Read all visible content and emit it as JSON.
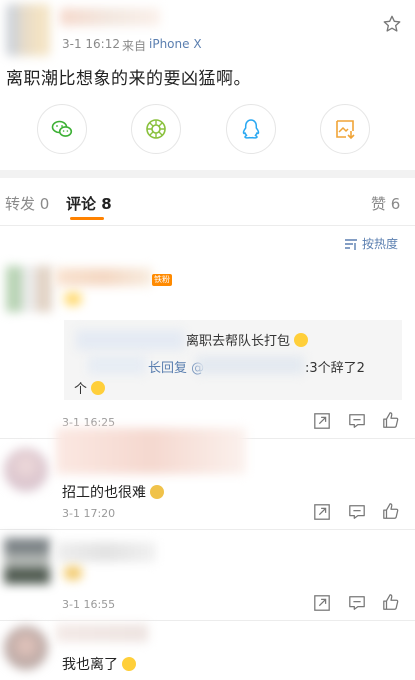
{
  "post": {
    "time": "3-1 16:12",
    "source_prefix": "来自",
    "device": "iPhone X",
    "text": "离职潮比想象的来的要凶猛啊。"
  },
  "share": {
    "icons": [
      "wechat-icon",
      "moments-icon",
      "qq-icon",
      "save-image-icon"
    ]
  },
  "tabs": {
    "repost": "转发 0",
    "comments": "评论 8",
    "likes": "赞 6"
  },
  "sort": {
    "label": "按热度"
  },
  "comments": [
    {
      "badge": "铁粉",
      "reply": {
        "line1": "离职去帮队长打包",
        "line2a": "长回复",
        "line2_at": "@",
        "line2b": ":3个辞了2",
        "line3": "个"
      },
      "time": "3-1 16:25"
    },
    {
      "text": "招工的也很难",
      "time": "3-1 17:20"
    },
    {
      "time": "3-1 16:55"
    },
    {
      "text": "我也离了"
    }
  ],
  "colors": {
    "accent": "#ff8200",
    "link": "#5b7fb0",
    "wechat": "#3cb034",
    "moments": "#8ac13d",
    "qq": "#2aa8f2",
    "save": "#f0a437"
  }
}
